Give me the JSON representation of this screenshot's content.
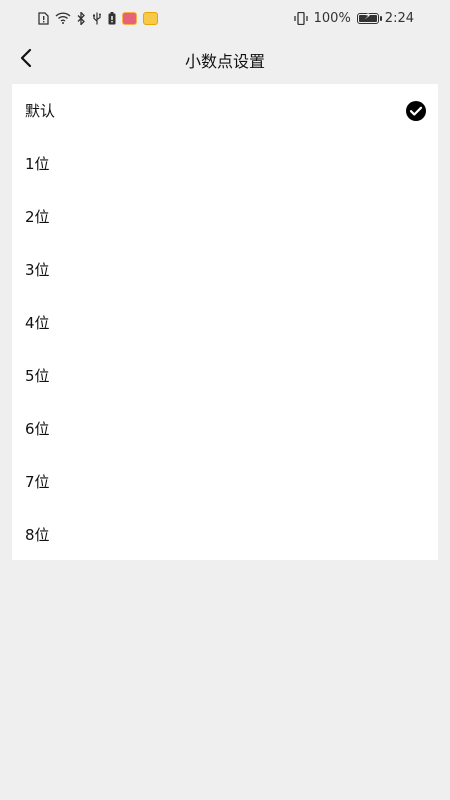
{
  "status_bar": {
    "battery_level": "100%",
    "time": "2:24",
    "battery_fill": 1.0,
    "icons_left": [
      "sim-alert-icon",
      "wifi-icon",
      "bluetooth-icon",
      "usb-icon",
      "battery-alert-icon",
      "app-notification-icon",
      "app-notification-icon"
    ],
    "icons_right": [
      "vibrate-icon",
      "battery-charging-icon"
    ]
  },
  "header": {
    "title": "小数点设置"
  },
  "options": [
    {
      "label": "默认",
      "selected": true
    },
    {
      "label": "1位",
      "selected": false
    },
    {
      "label": "2位",
      "selected": false
    },
    {
      "label": "3位",
      "selected": false
    },
    {
      "label": "4位",
      "selected": false
    },
    {
      "label": "5位",
      "selected": false
    },
    {
      "label": "6位",
      "selected": false
    },
    {
      "label": "7位",
      "selected": false
    },
    {
      "label": "8位",
      "selected": false
    }
  ],
  "colors": {
    "background": "#efefef",
    "card": "#ffffff",
    "text": "#111111",
    "check": "#000000"
  }
}
